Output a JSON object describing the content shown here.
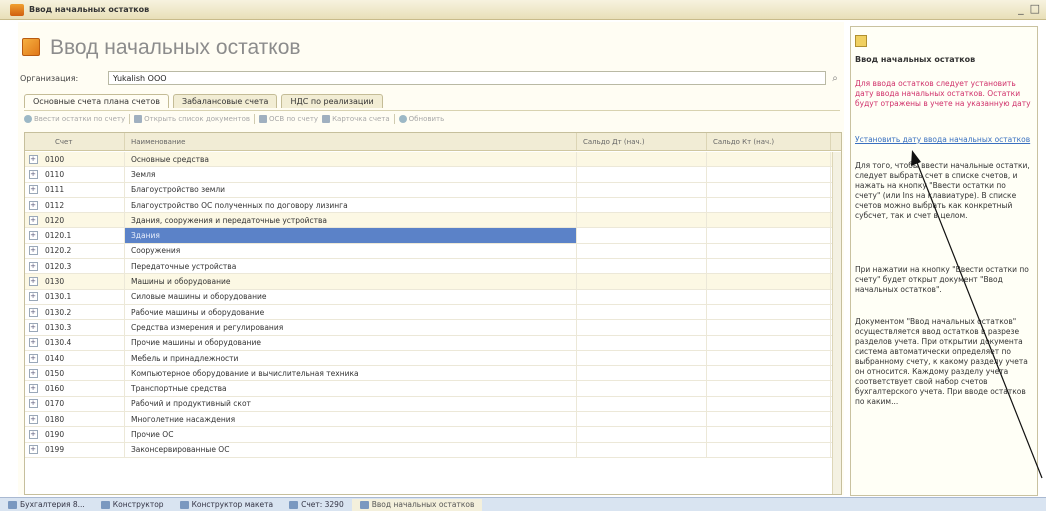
{
  "window": {
    "title": "Ввод начальных остатков",
    "controls": [
      "_",
      "□",
      "×"
    ]
  },
  "form": {
    "title": "Ввод начальных остатков",
    "org_label": "Организация:",
    "org_value": "Yukalish OOO"
  },
  "tabs": [
    {
      "label": "Основные счета плана счетов",
      "active": true
    },
    {
      "label": "Забалансовые счета",
      "active": false
    },
    {
      "label": "НДС по реализации",
      "active": false
    }
  ],
  "toolbar": {
    "enter_balances": "Ввести остатки по счету",
    "open_docs": "Открыть список документов",
    "osv": "ОСВ по счету",
    "account_card": "Карточка счета",
    "refresh": "Обновить"
  },
  "grid": {
    "columns": {
      "account": "Счет",
      "name": "Наименование",
      "dt": "Сальдо Дт (нач.)",
      "kt": "Сальдо Кт (нач.)"
    },
    "rows": [
      {
        "account": "0100",
        "name": "Основные средства",
        "group": true,
        "selected": false
      },
      {
        "account": "0110",
        "name": "Земля",
        "group": false,
        "selected": false
      },
      {
        "account": "0111",
        "name": "Благоустройство земли",
        "group": false,
        "selected": false
      },
      {
        "account": "0112",
        "name": "Благоустройство ОС полученных по договору лизинга",
        "group": false,
        "selected": false
      },
      {
        "account": "0120",
        "name": "Здания, сооружения и передаточные устройства",
        "group": true,
        "selected": false
      },
      {
        "account": "0120.1",
        "name": "Здания",
        "group": false,
        "selected": true
      },
      {
        "account": "0120.2",
        "name": "Сооружения",
        "group": false,
        "selected": false
      },
      {
        "account": "0120.3",
        "name": "Передаточные устройства",
        "group": false,
        "selected": false
      },
      {
        "account": "0130",
        "name": "Машины и оборудование",
        "group": true,
        "selected": false
      },
      {
        "account": "0130.1",
        "name": "Силовые машины и оборудование",
        "group": false,
        "selected": false
      },
      {
        "account": "0130.2",
        "name": "Рабочие машины и оборудование",
        "group": false,
        "selected": false
      },
      {
        "account": "0130.3",
        "name": "Средства измерения и регулирования",
        "group": false,
        "selected": false
      },
      {
        "account": "0130.4",
        "name": "Прочие машины и оборудование",
        "group": false,
        "selected": false
      },
      {
        "account": "0140",
        "name": "Мебель и принадлежности",
        "group": false,
        "selected": false
      },
      {
        "account": "0150",
        "name": "Компьютерное оборудование и вычислительная техника",
        "group": false,
        "selected": false
      },
      {
        "account": "0160",
        "name": "Транспортные средства",
        "group": false,
        "selected": false
      },
      {
        "account": "0170",
        "name": "Рабочий и продуктивный скот",
        "group": false,
        "selected": false
      },
      {
        "account": "0180",
        "name": "Многолетние насаждения",
        "group": false,
        "selected": false
      },
      {
        "account": "0190",
        "name": "Прочие ОС",
        "group": false,
        "selected": false
      },
      {
        "account": "0199",
        "name": "Законсервированные ОС",
        "group": false,
        "selected": false
      }
    ]
  },
  "side": {
    "title": "Ввод начальных остатков",
    "warning": "Для ввода остатков следует установить дату ввода начальных остатков. Остатки будут отражены в учете на указанную дату",
    "link": "Установить дату ввода начальных остатков",
    "p1": "Для того, чтобы ввести начальные остатки, следует выбрать счет в списке счетов, и нажать на кнопку \"Ввести остатки по счету\" (или Ins на клавиатуре). В списке счетов можно выбрать как конкретный субсчет, так и счет в целом.",
    "p2": "При нажатии на кнопку \"Ввести остатки по счету\" будет открыт документ \"Ввод начальных остатков\".",
    "p3": "Документом \"Ввод начальных остатков\" осуществляется ввод остатков в разрезе разделов учета. При открытии документа система автоматически определяет по выбранному счету, к какому разделу учета он относится. Каждому разделу учета соответствует свой набор счетов бухгалтерского учета. При вводе остатков по каким..."
  },
  "taskbar": [
    {
      "label": "Бухгалтерия 8...",
      "active": false
    },
    {
      "label": "Конструктор",
      "active": false
    },
    {
      "label": "Конструктор макета",
      "active": false
    },
    {
      "label": "Счет: 3290",
      "active": false
    },
    {
      "label": "Ввод начальных остатков",
      "active": true
    }
  ]
}
